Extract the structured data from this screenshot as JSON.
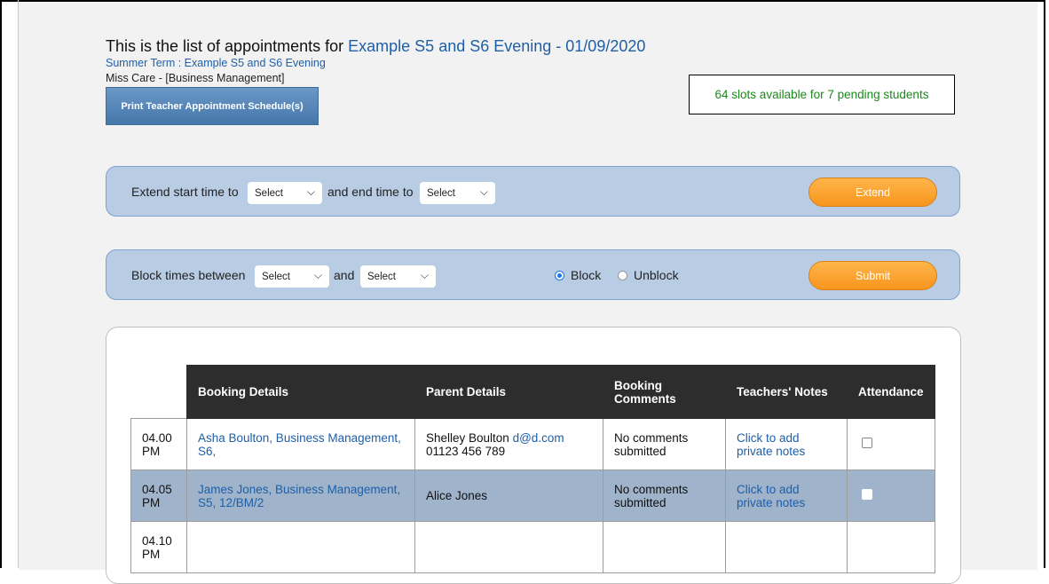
{
  "heading": {
    "prefix": "This is the list of appointments for",
    "event": "Example S5 and S6 Evening - 01/09/2020"
  },
  "subtitle": "Summer Term : Example S5 and S6 Evening",
  "teacher": "Miss Care - [Business Management]",
  "print_button": "Print Teacher Appointment Schedule(s)",
  "slots_info": "64 slots available for 7 pending students",
  "extend_bar": {
    "label_start": "Extend start time to",
    "start_select": "Select",
    "label_end": "and end time to",
    "end_select": "Select",
    "button": "Extend"
  },
  "block_bar": {
    "label_start": "Block times between",
    "start_select": "Select",
    "label_and": "and",
    "end_select": "Select",
    "radio_block": "Block",
    "radio_unblock": "Unblock",
    "selected": "Block",
    "button": "Submit"
  },
  "table": {
    "headers": [
      "Booking Details",
      "Parent Details",
      "Booking Comments",
      "Teachers' Notes",
      "Attendance"
    ],
    "rows": [
      {
        "time": "04.00 PM",
        "booking": "Asha Boulton, Business Management, S6,",
        "parent_name": "Shelley Boulton",
        "parent_email": "d@d.com",
        "parent_phone": "01123 456 789",
        "comments": "No comments submitted",
        "notes": "Click to add private notes",
        "attendance": false
      },
      {
        "time": "04.05 PM",
        "booking": "James Jones, Business Management, S5, 12/BM/2",
        "parent_name": "Alice Jones",
        "parent_email": "",
        "parent_phone": "",
        "comments": "No comments submitted",
        "notes": "Click to add private notes",
        "attendance": false
      },
      {
        "time": "04.10 PM",
        "booking": "",
        "parent_name": "",
        "parent_email": "",
        "parent_phone": "",
        "comments": "",
        "notes": "",
        "attendance": null
      }
    ]
  },
  "colors": {
    "accent_blue": "#1e5fa8",
    "bar_bg": "#b8cce4",
    "orange_button": "#f7961e",
    "success_green": "#1a8a1a",
    "header_dark": "#2d2d2d",
    "row_highlight": "#9fb3cb"
  }
}
